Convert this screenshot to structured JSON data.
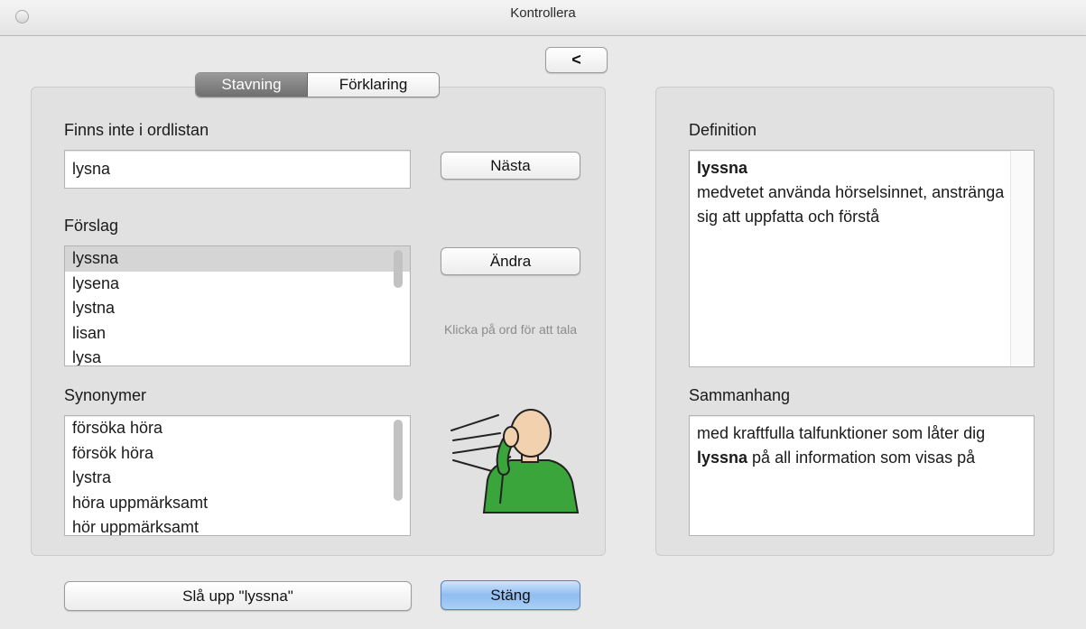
{
  "window": {
    "title": "Kontrollera"
  },
  "toolbar": {
    "back_label": "<"
  },
  "tabs": [
    {
      "label": "Stavning",
      "active": true
    },
    {
      "label": "Förklaring",
      "active": false
    }
  ],
  "not_in_dictionary": {
    "label": "Finns inte i ordlistan",
    "value": "lysna",
    "next_button": "Nästa"
  },
  "suggestions": {
    "label": "Förslag",
    "items": [
      "lyssna",
      "lysena",
      "lystna",
      "lisan",
      "lysa"
    ],
    "selected_index": 0,
    "change_button": "Ändra"
  },
  "hint": {
    "text": "Klicka på ord för att tala"
  },
  "synonyms": {
    "label": "Synonymer",
    "items": [
      "försöka höra",
      "försök höra",
      "lystra",
      "höra uppmärksamt",
      "hör uppmärksamt"
    ]
  },
  "definition": {
    "label": "Definition",
    "word": "lyssna",
    "text": "medvetet använda hörselsinnet, anstränga sig att uppfatta och förstå"
  },
  "context": {
    "label": "Sammanhang",
    "before": "med kraftfulla talfunktioner som låter dig ",
    "word": "lyssna",
    "after": " på all information som visas på"
  },
  "footer": {
    "lookup_button": "Slå upp \"lyssna\"",
    "close_button": "Stäng"
  },
  "colors": {
    "window_bg": "#e9e9e9",
    "panel_bg": "#e1e1e1",
    "selection": "#d5d5d5",
    "primary_button": "#8fbdf0",
    "pictogram_shirt": "#3aa53a",
    "pictogram_skin": "#f2d2ae"
  },
  "icons": {
    "pictogram": "person-listening-pictogram"
  }
}
